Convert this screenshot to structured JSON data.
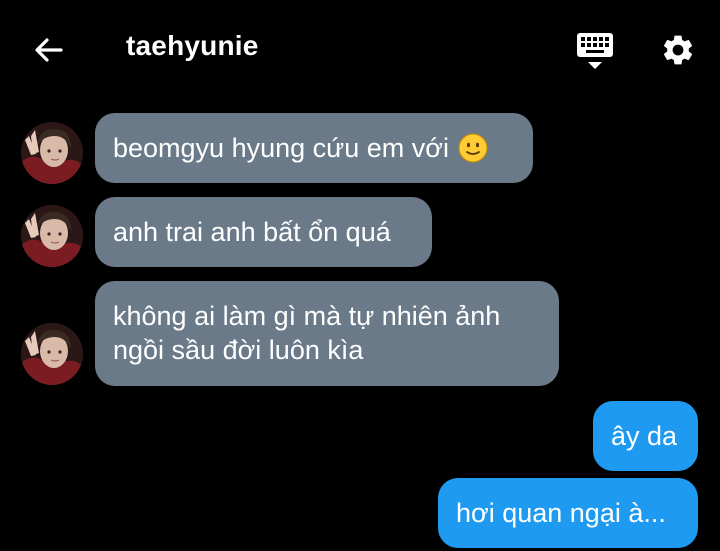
{
  "header": {
    "contact_name": "taehyunie",
    "back_icon": "arrow-left-icon",
    "keyboard_icon": "keyboard-icon",
    "settings_icon": "gear-icon"
  },
  "colors": {
    "background": "#000000",
    "incoming_bubble": "#6a7a89",
    "outgoing_bubble": "#1e9bf0",
    "text": "#ffffff"
  },
  "messages": {
    "incoming": [
      {
        "text": "beomgyu hyung cứu em với",
        "emoji": "slightly-smiling-face"
      },
      {
        "text": "anh trai anh bất ổn quá"
      },
      {
        "lines": [
          "không ai làm gì mà tự nhiên ảnh",
          "ngồi sầu đời luôn kìa"
        ]
      }
    ],
    "outgoing": [
      {
        "text": "ây da"
      },
      {
        "text": "hơi quan ngại à..."
      }
    ]
  }
}
